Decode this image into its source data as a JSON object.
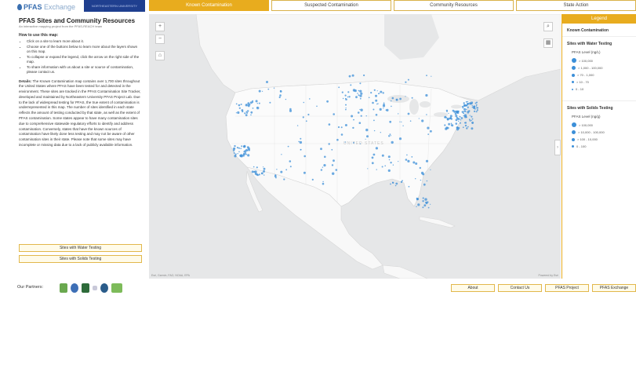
{
  "header": {
    "logo_main": "PFAS",
    "logo_sub": " Exchange",
    "banner_text": "NORTHEASTERN UNIVERSITY"
  },
  "tabs": [
    {
      "label": "Known Contamination",
      "active": true
    },
    {
      "label": "Suspected Contamination",
      "active": false
    },
    {
      "label": "Community Resources",
      "active": false
    },
    {
      "label": "State Action",
      "active": false
    }
  ],
  "left_panel": {
    "title": "PFAS Sites and Community Resources",
    "subtitle": "An interactive mapping project from the PFAS-REACH team",
    "howto_heading": "How to use this map:",
    "howto_items": [
      "Click on a site to learn more about it.",
      "Choose one of the buttons below to learn more about the layers shown on this map.",
      "To collapse or expand the legend, click the arrow on the right side of the map.",
      "To share information with us about a site or source of contamination, please contact us."
    ],
    "details_label": "Details:",
    "details_text": "The Known Contamination map contains over 1,700 sites throughout the United States where PFAS have been tested for and detected in the environment. These sites are tracked in the PFAS Contamination Site Tracker, developed and maintained by Northeastern University PFAS Project Lab. Due to the lack of widespread testing for PFAS, the true extent of contamination is underrepresented in this map. The number of sites identified in each state reflects the amount of testing conducted by that state, as well as the extent of PFAS contamination. Some states appear to have many contamination sites due to comprehensive statewide regulatory efforts to identify and address contamination. Conversely, states that have the known sources of contamination have likely done less testing and may not be aware of other contamination sites in their state. Please note that some sites may have incomplete or missing data due to a lack of publicly available information.",
    "button_water": "Sites with Water Testing",
    "button_solids": "Sites with Solids Testing"
  },
  "map": {
    "zoom_in": "+",
    "zoom_out": "−",
    "country_label": "UNITED STATES",
    "attribution_left": "Esri, Garmin, FAO, NOAA, EPA",
    "attribution_right": "Powered by Esri"
  },
  "legend": {
    "header": "Legend",
    "title": "Known Contamination",
    "water_section": "Sites with Water Testing",
    "water_unit": "PFAS Level (ng/L)",
    "water_items": [
      "> 100,000",
      "> 1,000 - 100,000",
      "> 70 - 1,000",
      "> 10 - 70",
      "0 - 10"
    ],
    "solids_section": "Sites with Solids Testing",
    "solids_unit": "PFAS Level (ng/g)",
    "solids_items": [
      "> 100,000",
      "> 10,000 - 100,000",
      "> 100 - 10,000",
      "0 - 100"
    ],
    "dot_color": "#3c8fd8"
  },
  "footer": {
    "partners_label": "Our Partners:",
    "buttons": [
      "About",
      "Contact Us",
      "PFAS Project",
      "PFAS Exchange"
    ]
  }
}
